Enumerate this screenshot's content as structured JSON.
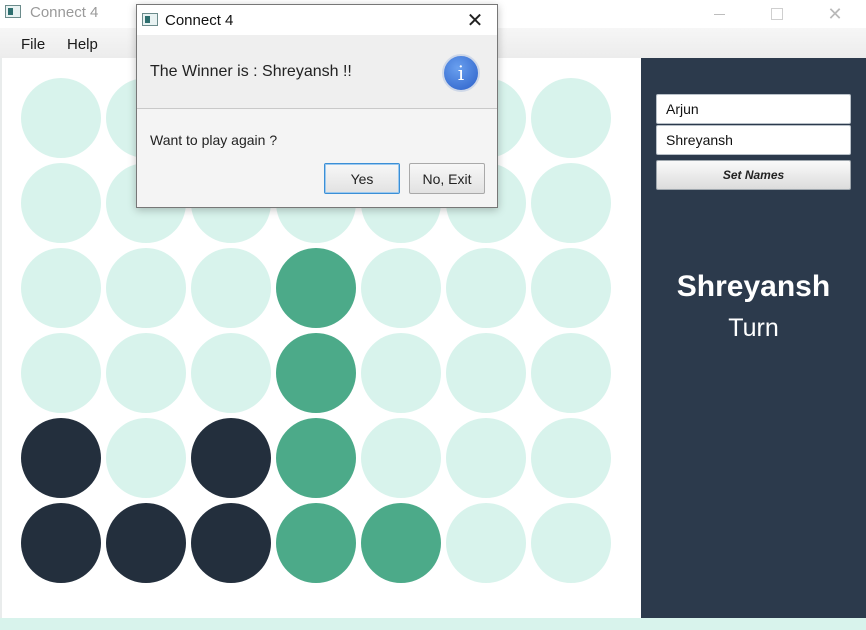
{
  "window": {
    "title": "Connect 4",
    "minimize_glyph": "—",
    "close_glyph": "✕"
  },
  "menu": {
    "items": [
      {
        "label": "File"
      },
      {
        "label": "Help"
      }
    ]
  },
  "colors": {
    "empty": "#d8f3ec",
    "player1": "#232f3d",
    "player2": "#4caa89",
    "side_panel": "#2c3a4c"
  },
  "board": {
    "columns": 7,
    "rows": 6,
    "cells": [
      [
        "E",
        "E",
        "E",
        "E",
        "E",
        "E",
        "E"
      ],
      [
        "E",
        "E",
        "E",
        "E",
        "E",
        "E",
        "E"
      ],
      [
        "E",
        "E",
        "E",
        "P2",
        "E",
        "E",
        "E"
      ],
      [
        "E",
        "E",
        "E",
        "P2",
        "E",
        "E",
        "E"
      ],
      [
        "P1",
        "E",
        "P1",
        "P2",
        "E",
        "E",
        "E"
      ],
      [
        "P1",
        "P1",
        "P1",
        "P2",
        "P2",
        "E",
        "E"
      ]
    ]
  },
  "side": {
    "player1_name": "Arjun",
    "player2_name": "Shreyansh",
    "set_names_label": "Set Names",
    "current_player": "Shreyansh",
    "turn_label": "Turn"
  },
  "dialog": {
    "title": "Connect 4",
    "close_glyph": "✕",
    "header": "The Winner is : Shreyansh !!",
    "info_glyph": "i",
    "content": "Want to play again ?",
    "yes_label": "Yes",
    "no_label": "No, Exit"
  }
}
